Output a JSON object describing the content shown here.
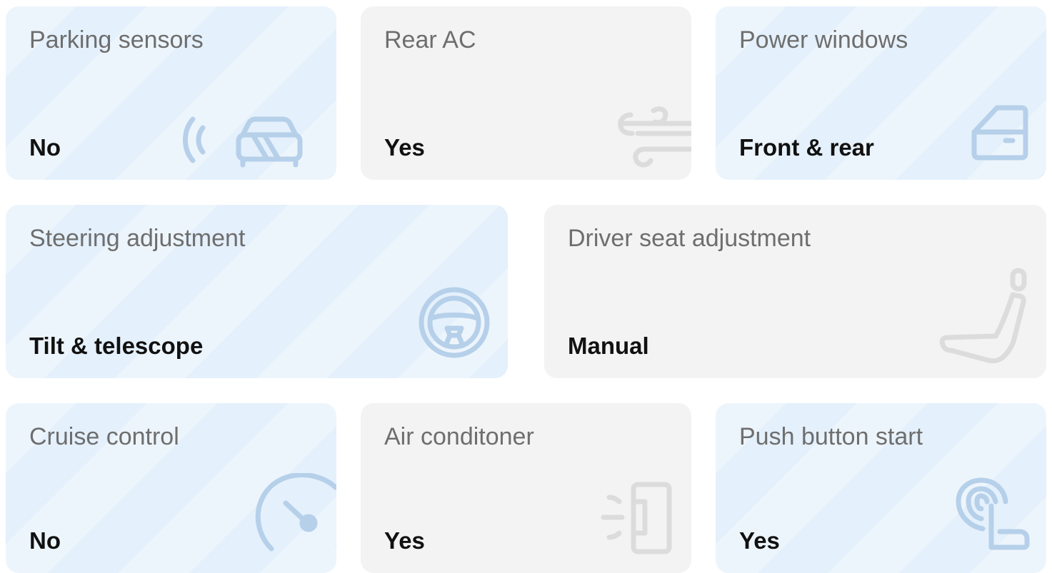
{
  "features": [
    {
      "title": "Parking sensors",
      "value": "No",
      "icon": "parking-sensor-icon",
      "theme": "blue"
    },
    {
      "title": "Rear AC",
      "value": "Yes",
      "icon": "wind-icon",
      "theme": "gray"
    },
    {
      "title": "Power windows",
      "value": "Front & rear",
      "icon": "car-door-icon",
      "theme": "blue"
    },
    {
      "title": "Steering adjustment",
      "value": "Tilt & telescope",
      "icon": "steering-wheel-icon",
      "theme": "blue"
    },
    {
      "title": "Driver seat adjustment",
      "value": "Manual",
      "icon": "car-seat-icon",
      "theme": "gray"
    },
    {
      "title": "Cruise control",
      "value": "No",
      "icon": "speedometer-icon",
      "theme": "blue"
    },
    {
      "title": "Air conditoner",
      "value": "Yes",
      "icon": "air-conditioner-icon",
      "theme": "gray"
    },
    {
      "title": "Push button start",
      "value": "Yes",
      "icon": "push-button-start-icon",
      "theme": "blue"
    }
  ],
  "colors": {
    "blue_card": "#e4f0fb",
    "gray_card": "#f3f3f3",
    "title_text": "#6e6e6e",
    "value_text": "#111111",
    "blue_icon": "#b6d0ea",
    "gray_icon": "#dcdcdc"
  }
}
